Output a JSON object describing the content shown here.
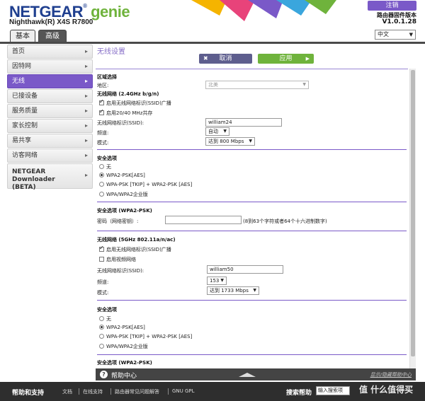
{
  "header": {
    "brand": "NETGEAR",
    "genie": "genie",
    "model": "Nighthawk(R) X4S R7800",
    "logout": "注销",
    "firmware_label": "路由器固件版本",
    "firmware_version": "V1.0.1.28",
    "tabs": [
      {
        "label": "基本"
      },
      {
        "label": "高级"
      }
    ],
    "language": "中文"
  },
  "sidebar": {
    "items": [
      {
        "label": "首页"
      },
      {
        "label": "因特网"
      },
      {
        "label": "无线"
      },
      {
        "label": "已接设备"
      },
      {
        "label": "服务质量"
      },
      {
        "label": "家长控制"
      },
      {
        "label": "易共享"
      },
      {
        "label": "访客网络"
      },
      {
        "label": "NETGEAR Downloader (BETA)"
      }
    ]
  },
  "main": {
    "title": "无线设置",
    "cancel": "取消",
    "apply": "应用",
    "region_section": "区域选择",
    "region_label": "地区:",
    "region_value": "北美",
    "wn24": {
      "title": "无线网络 (2.4GHz b/g/n)",
      "broadcast": "启用无线网络标识(SSID)广播",
      "coexist": "启用20/40 MHz共存",
      "ssid_label": "无线网络标识(SSID):",
      "ssid": "william24",
      "channel_label": "频道:",
      "channel": "自动",
      "mode_label": "模式:",
      "mode": "达到 800 Mbps"
    },
    "sec1": {
      "title": "安全选项",
      "options": [
        "无",
        "WPA2-PSK[AES]",
        "WPA-PSK [TKIP] + WPA2-PSK [AES]",
        "WPA/WPA2企业版"
      ]
    },
    "pass1": {
      "title": "安全选项 (WPA2-PSK)",
      "label": "密码（网络密钥）:",
      "hint": "(8到63个字符或者64个十六进制数字)"
    },
    "wn5": {
      "title": "无线网络 (5GHz 802.11a/n/ac)",
      "broadcast": "启用无线网络标识(SSID)广播",
      "video": "启用视频网络",
      "ssid_label": "无线网络标识(SSID):",
      "ssid": "william50",
      "channel_label": "频道:",
      "channel": "153",
      "mode_label": "模式:",
      "mode": "达到 1733 Mbps"
    },
    "sec2": {
      "title": "安全选项",
      "options": [
        "无",
        "WPA2-PSK[AES]",
        "WPA-PSK [TKIP] + WPA2-PSK [AES]",
        "WPA/WPA2企业版"
      ]
    },
    "pass2_title": "安全选项 (WPA2-PSK)"
  },
  "help": {
    "title": "帮助中心",
    "toggle": "显示/隐藏帮助中心"
  },
  "footer": {
    "title": "帮助和支持",
    "links": [
      "文档",
      "在线支持",
      "路由器常见问题解答",
      "GNU GPL"
    ],
    "search_label": "搜索帮助",
    "search_placeholder": "输入搜索项"
  },
  "watermark": "值 什么值得买"
}
